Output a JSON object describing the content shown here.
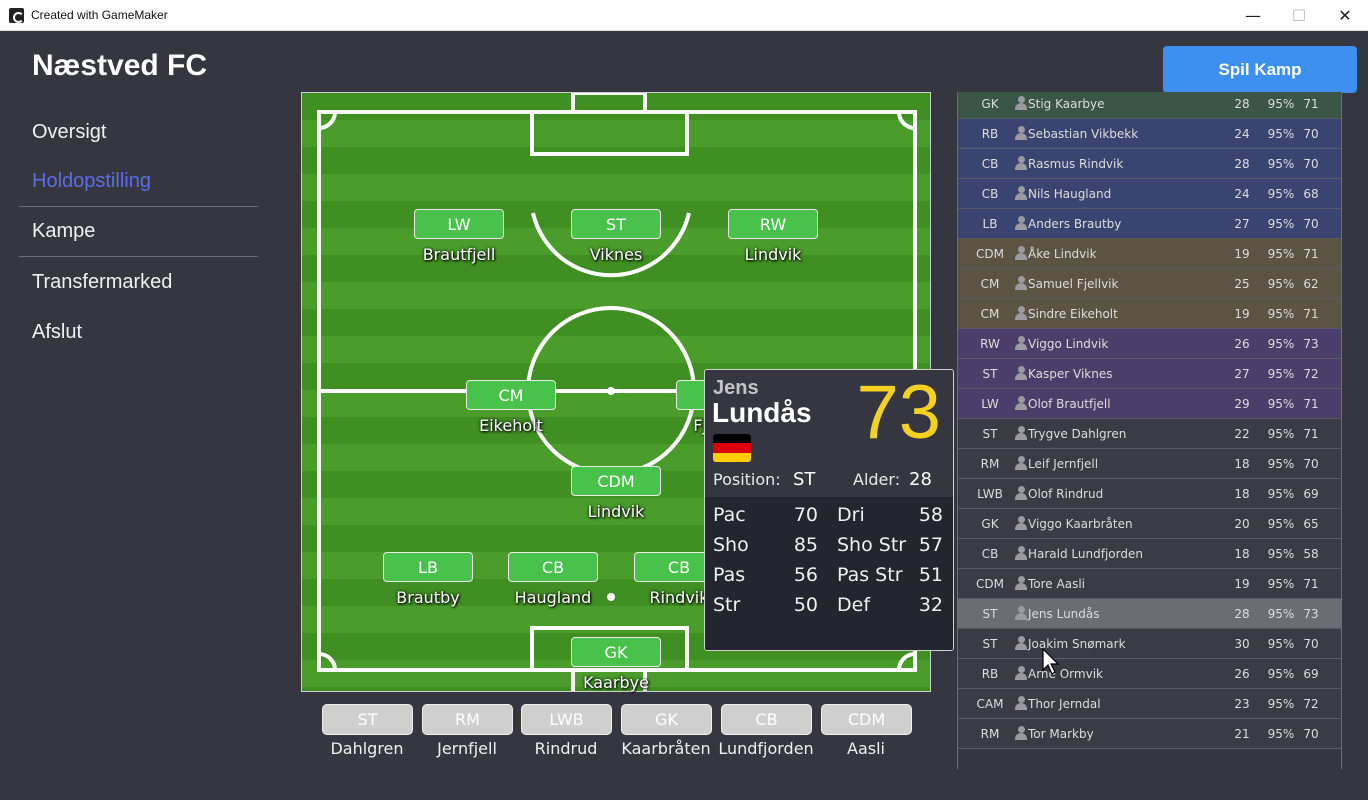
{
  "window": {
    "title": "Created with GameMaker",
    "min": "—",
    "max": "☐",
    "close": "✕"
  },
  "club_name": "Næstved FC",
  "play_button": "Spil Kamp",
  "nav": [
    "Oversigt",
    "Holdopstilling",
    "Kampe",
    "Transfermarked",
    "Afslut"
  ],
  "nav_active": "Holdopstilling",
  "pitch": {
    "lw": {
      "pos": "LW",
      "name": "Brautfjell"
    },
    "st": {
      "pos": "ST",
      "name": "Viknes"
    },
    "rw": {
      "pos": "RW",
      "name": "Lindvik"
    },
    "cm1": {
      "pos": "CM",
      "name": "Eikeholt"
    },
    "cm2": {
      "pos": "CM",
      "name": "Fjellvik"
    },
    "cdm": {
      "pos": "CDM",
      "name": "Lindvik"
    },
    "lb": {
      "pos": "LB",
      "name": "Brautby"
    },
    "cb1": {
      "pos": "CB",
      "name": "Haugland"
    },
    "cb2": {
      "pos": "CB",
      "name": "Rindvik"
    },
    "gk": {
      "pos": "GK",
      "name": "Kaarbye"
    }
  },
  "bench": [
    {
      "pos": "ST",
      "name": "Dahlgren"
    },
    {
      "pos": "RM",
      "name": "Jernfjell"
    },
    {
      "pos": "LWB",
      "name": "Rindrud"
    },
    {
      "pos": "GK",
      "name": "Kaarbråten"
    },
    {
      "pos": "CB",
      "name": "Lundfjorden"
    },
    {
      "pos": "CDM",
      "name": "Aasli"
    }
  ],
  "squad": [
    {
      "pos": "GK",
      "name": "Stig Kaarbye",
      "age": "28",
      "fit": "95%",
      "ovr": "71",
      "group": "gk"
    },
    {
      "pos": "RB",
      "name": "Sebastian Vikbekk",
      "age": "24",
      "fit": "95%",
      "ovr": "70",
      "group": "def"
    },
    {
      "pos": "CB",
      "name": "Rasmus Rindvik",
      "age": "28",
      "fit": "95%",
      "ovr": "70",
      "group": "def"
    },
    {
      "pos": "CB",
      "name": "Nils Haugland",
      "age": "24",
      "fit": "95%",
      "ovr": "68",
      "group": "def"
    },
    {
      "pos": "LB",
      "name": "Anders Brautby",
      "age": "27",
      "fit": "95%",
      "ovr": "70",
      "group": "def"
    },
    {
      "pos": "CDM",
      "name": "Åke Lindvik",
      "age": "19",
      "fit": "95%",
      "ovr": "71",
      "group": "mid"
    },
    {
      "pos": "CM",
      "name": "Samuel Fjellvik",
      "age": "25",
      "fit": "95%",
      "ovr": "62",
      "group": "mid"
    },
    {
      "pos": "CM",
      "name": "Sindre Eikeholt",
      "age": "19",
      "fit": "95%",
      "ovr": "71",
      "group": "mid"
    },
    {
      "pos": "RW",
      "name": "Viggo Lindvik",
      "age": "26",
      "fit": "95%",
      "ovr": "73",
      "group": "att"
    },
    {
      "pos": "ST",
      "name": "Kasper Viknes",
      "age": "27",
      "fit": "95%",
      "ovr": "72",
      "group": "att"
    },
    {
      "pos": "LW",
      "name": "Olof Brautfjell",
      "age": "29",
      "fit": "95%",
      "ovr": "71",
      "group": "att"
    },
    {
      "pos": "ST",
      "name": "Trygve Dahlgren",
      "age": "22",
      "fit": "95%",
      "ovr": "71",
      "group": "sub"
    },
    {
      "pos": "RM",
      "name": "Leif Jernfjell",
      "age": "18",
      "fit": "95%",
      "ovr": "70",
      "group": "sub"
    },
    {
      "pos": "LWB",
      "name": "Olof Rindrud",
      "age": "18",
      "fit": "95%",
      "ovr": "69",
      "group": "sub"
    },
    {
      "pos": "GK",
      "name": "Viggo Kaarbråten",
      "age": "20",
      "fit": "95%",
      "ovr": "65",
      "group": "sub"
    },
    {
      "pos": "CB",
      "name": "Harald Lundfjorden",
      "age": "18",
      "fit": "95%",
      "ovr": "58",
      "group": "sub"
    },
    {
      "pos": "CDM",
      "name": "Tore Aasli",
      "age": "19",
      "fit": "95%",
      "ovr": "71",
      "group": "sub"
    },
    {
      "pos": "ST",
      "name": "Jens Lundås",
      "age": "28",
      "fit": "95%",
      "ovr": "73",
      "group": "hover"
    },
    {
      "pos": "ST",
      "name": "Joakim Snømark",
      "age": "30",
      "fit": "95%",
      "ovr": "70",
      "group": "res"
    },
    {
      "pos": "RB",
      "name": "Arne Ormvik",
      "age": "26",
      "fit": "95%",
      "ovr": "69",
      "group": "res"
    },
    {
      "pos": "CAM",
      "name": "Thor Jerndal",
      "age": "23",
      "fit": "95%",
      "ovr": "72",
      "group": "res"
    },
    {
      "pos": "RM",
      "name": "Tor Markby",
      "age": "21",
      "fit": "95%",
      "ovr": "70",
      "group": "res"
    }
  ],
  "group_colors": {
    "gk": "#3b5646",
    "def": "#3a4470",
    "mid": "#5c5443",
    "att": "#4d3d6a",
    "sub": "#3a3b45",
    "hover": "#6b6c74",
    "res": "#3a3b45"
  },
  "player_card": {
    "first_name": "Jens",
    "last_name": "Lundås",
    "rating": "73",
    "flag": "germany-flag",
    "position_label": "Position:",
    "position": "ST",
    "age_label": "Alder:",
    "age": "28",
    "stats": [
      {
        "label": "Pac",
        "value": "70"
      },
      {
        "label": "Dri",
        "value": "58"
      },
      {
        "label": "Sho",
        "value": "85"
      },
      {
        "label": "Sho Str",
        "value": "57"
      },
      {
        "label": "Pas",
        "value": "56"
      },
      {
        "label": "Pas Str",
        "value": "51"
      },
      {
        "label": "Str",
        "value": "50"
      },
      {
        "label": "Def",
        "value": "32"
      }
    ]
  }
}
